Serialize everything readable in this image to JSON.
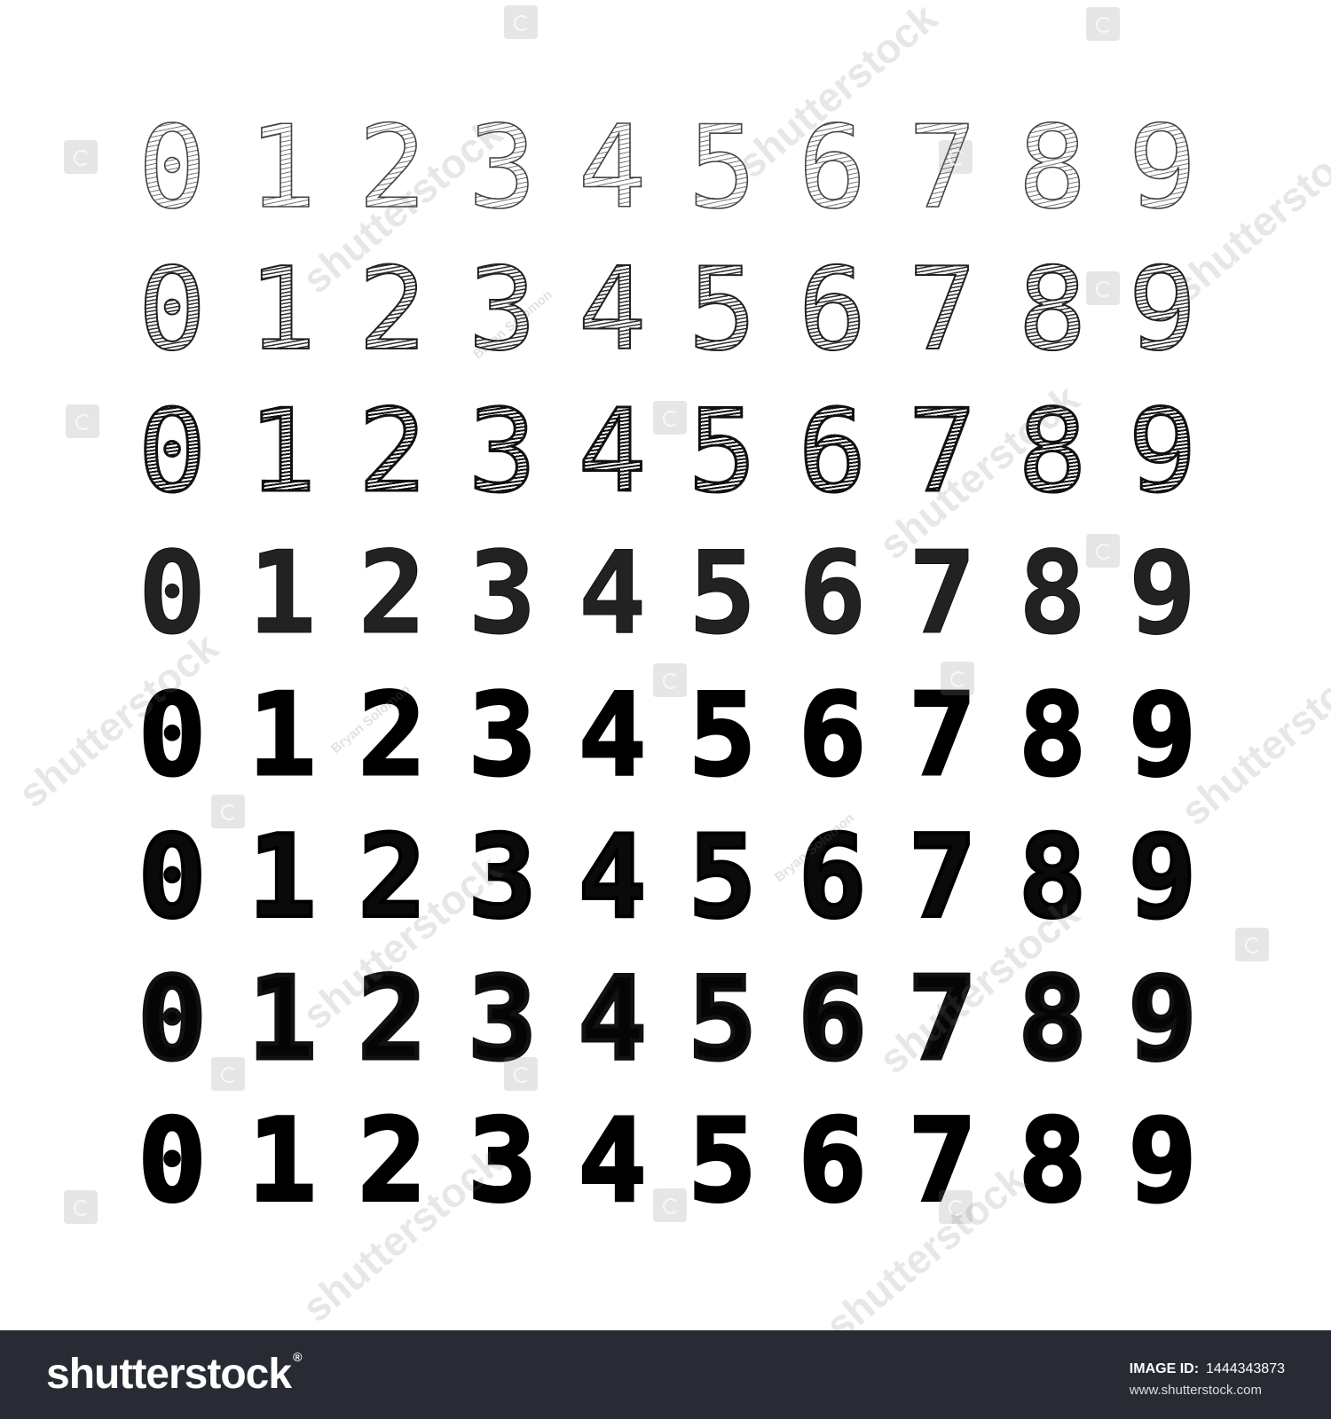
{
  "digits": [
    "0",
    "1",
    "2",
    "3",
    "4",
    "5",
    "6",
    "7",
    "8",
    "9"
  ],
  "rows": [
    {
      "style": "light-outline"
    },
    {
      "style": "medium-outline"
    },
    {
      "style": "dark-outline"
    },
    {
      "style": "scribble-bold"
    },
    {
      "style": "solid-bold"
    },
    {
      "style": "heavy-scribble"
    },
    {
      "style": "heavy-rough"
    },
    {
      "style": "solid-bold"
    }
  ],
  "watermark": {
    "brand": "shutterstock",
    "author": "Bryan Solomon"
  },
  "footer": {
    "brand": "shutterstock",
    "reg_mark": "®",
    "image_id_label": "IMAGE ID:",
    "image_id_value": "1444343873",
    "site": "www.shutterstock.com",
    "background": "#282b33"
  }
}
